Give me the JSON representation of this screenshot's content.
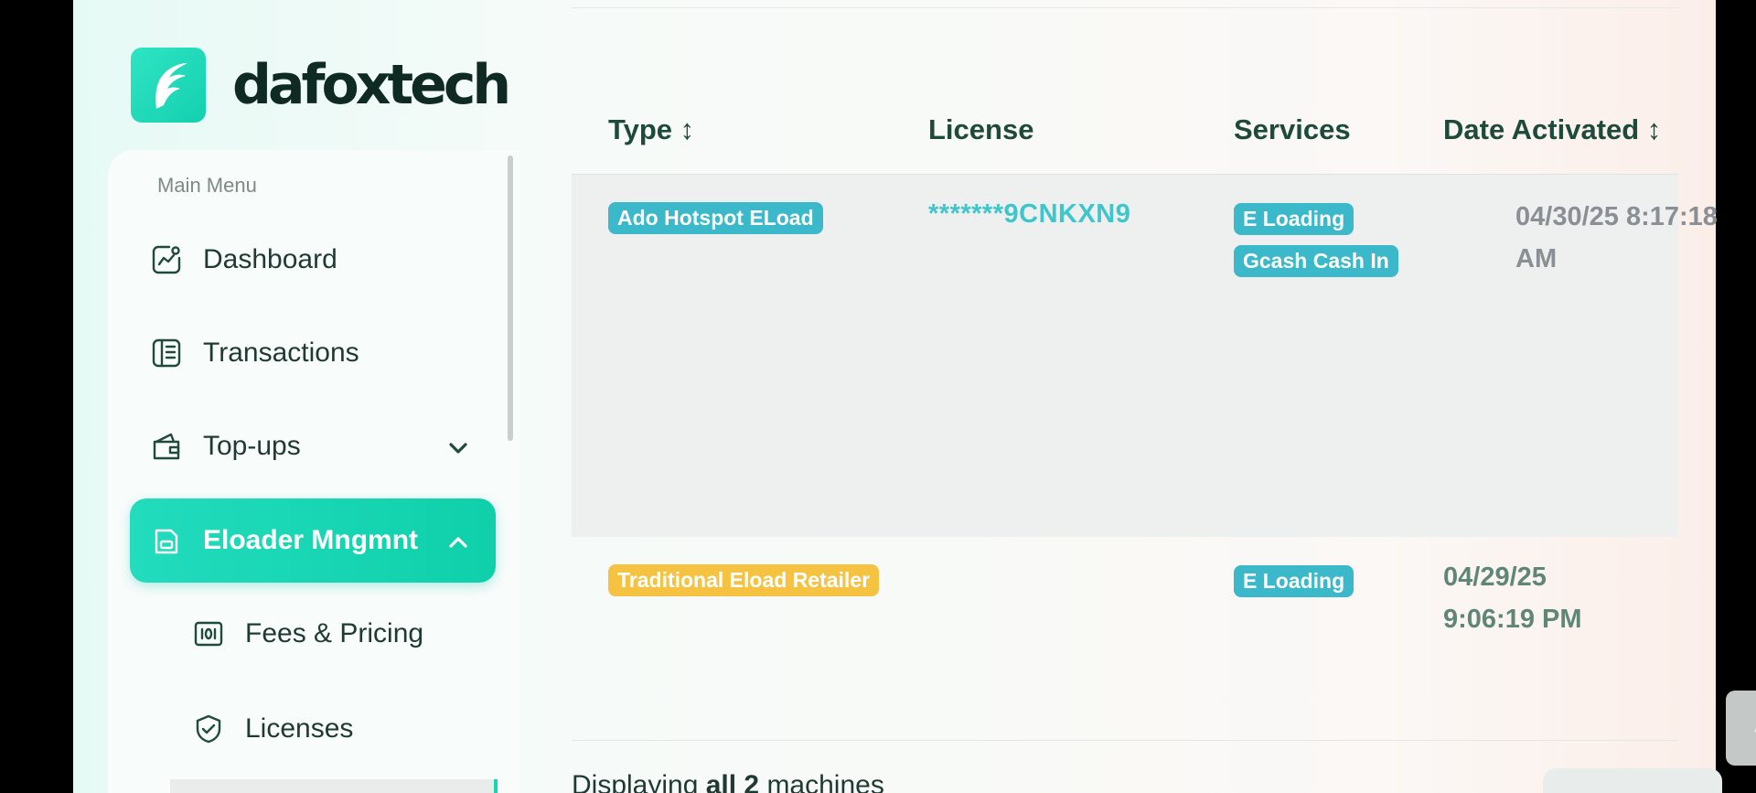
{
  "brand": {
    "name": "dafoxtech"
  },
  "sidebar": {
    "heading": "Main Menu",
    "items": [
      {
        "label": "Dashboard",
        "icon": "chart-line-icon"
      },
      {
        "label": "Transactions",
        "icon": "receipt-icon"
      },
      {
        "label": "Top-ups",
        "icon": "wallet-icon",
        "expandable": true,
        "expanded": false
      },
      {
        "label": "Eloader Mngmnt",
        "icon": "device-icon",
        "active": true,
        "expanded": true
      }
    ],
    "subitems": [
      {
        "label": "Fees & Pricing",
        "icon": "pricing-icon"
      },
      {
        "label": "Licenses",
        "icon": "shield-check-icon"
      }
    ]
  },
  "table": {
    "columns": [
      "Type ↕",
      "License",
      "Services",
      "Date Activated ↕"
    ],
    "rows": [
      {
        "type": "Ado Hotspot ELoad",
        "type_color": "#3bb8c9",
        "license": "*******9CNKXN9",
        "services": [
          "E Loading",
          "Gcash Cash In"
        ],
        "date_line1": "04/30/25 8:17:18",
        "date_line2": "AM",
        "date_color": "#8a8f96"
      },
      {
        "type": "Traditional Eload Retailer",
        "type_color": "#f5c242",
        "license": "",
        "services": [
          "E Loading"
        ],
        "date_line1": "04/29/25",
        "date_line2": "9:06:19 PM",
        "date_color": "#5f8677"
      }
    ]
  },
  "footer": {
    "display_prefix": "Displaying ",
    "display_bold": "all 2",
    "display_suffix": " machines"
  },
  "colors": {
    "accent": "#14d0ae",
    "service_badge": "#3bb8c9"
  }
}
